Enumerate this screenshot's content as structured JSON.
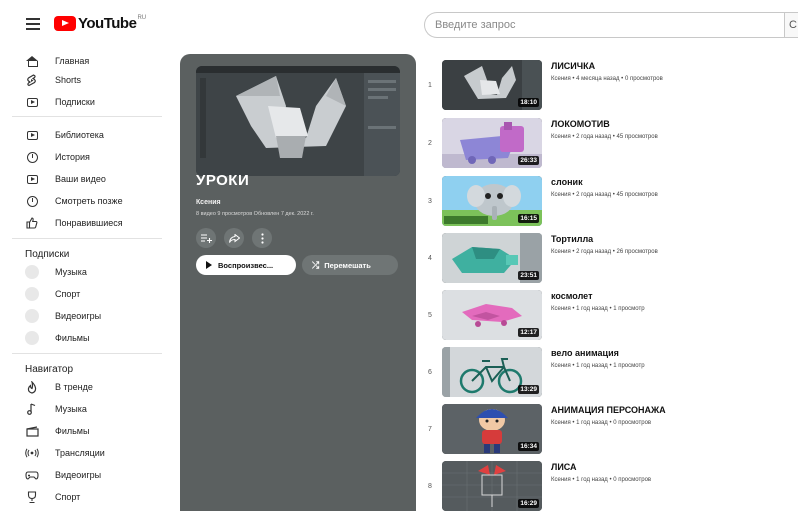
{
  "header": {
    "logo_text": "YouTube",
    "logo_sup": "RU",
    "search_placeholder": "Введите запрос",
    "search_button_text": "С"
  },
  "sidebar": {
    "main_items": [
      {
        "label": "Главная",
        "icon": "home-icon"
      },
      {
        "label": "Shorts",
        "icon": "shorts-icon"
      },
      {
        "label": "Подписки",
        "icon": "subscriptions-icon"
      }
    ],
    "library_items": [
      {
        "label": "Библиотека",
        "icon": "library-icon"
      },
      {
        "label": "История",
        "icon": "history-icon"
      },
      {
        "label": "Ваши видео",
        "icon": "your-videos-icon"
      },
      {
        "label": "Смотреть позже",
        "icon": "watch-later-icon"
      },
      {
        "label": "Понравившиеся",
        "icon": "liked-icon"
      }
    ],
    "subscriptions_title": "Подписки",
    "subscriptions": [
      {
        "label": "Музыка"
      },
      {
        "label": "Спорт"
      },
      {
        "label": "Видеоигры"
      },
      {
        "label": "Фильмы"
      }
    ],
    "navigator_title": "Навигатор",
    "navigator_items": [
      {
        "label": "В тренде",
        "icon": "trending-icon"
      },
      {
        "label": "Музыка",
        "icon": "music-icon"
      },
      {
        "label": "Фильмы",
        "icon": "films-icon"
      },
      {
        "label": "Трансляции",
        "icon": "live-icon"
      },
      {
        "label": "Видеоигры",
        "icon": "gaming-icon"
      },
      {
        "label": "Спорт",
        "icon": "sport-icon"
      }
    ]
  },
  "playlist": {
    "title": "УРОКИ",
    "owner": "Ксения",
    "meta": "8 видео  9 просмотров  Обновлен 7 дек. 2022 г.",
    "play_label": "Воспроизвес...",
    "shuffle_label": "Перемешать",
    "actions": [
      "add-to-queue-icon",
      "share-icon",
      "more-icon"
    ]
  },
  "videos": [
    {
      "index": "1",
      "title": "ЛИСИЧКА",
      "meta": "Ксения • 4 месяца назад • 0 просмотров",
      "duration": "18:10"
    },
    {
      "index": "2",
      "title": "ЛОКОМОТИВ",
      "meta": "Ксения • 2 года назад • 45 просмотров",
      "duration": "26:33"
    },
    {
      "index": "3",
      "title": "слоник",
      "meta": "Ксения • 2 года назад • 45 просмотров",
      "duration": "16:15"
    },
    {
      "index": "4",
      "title": "Тортилла",
      "meta": "Ксения • 2 года назад • 26 просмотров",
      "duration": "23:51"
    },
    {
      "index": "5",
      "title": "космолет",
      "meta": "Ксения • 1 год назад • 1 просмотр",
      "duration": "12:17"
    },
    {
      "index": "6",
      "title": "вело анимация",
      "meta": "Ксения • 1 год назад • 1 просмотр",
      "duration": "13:29"
    },
    {
      "index": "7",
      "title": "АНИМАЦИЯ ПЕРСОНАЖА",
      "meta": "Ксения • 1 год назад • 0 просмотров",
      "duration": "16:34"
    },
    {
      "index": "8",
      "title": "ЛИСА",
      "meta": "Ксения • 1 год назад • 0 просмотров",
      "duration": "16:29"
    }
  ],
  "colors": {
    "brand_red": "#ff0000",
    "panel_bg": "#5b6060"
  }
}
